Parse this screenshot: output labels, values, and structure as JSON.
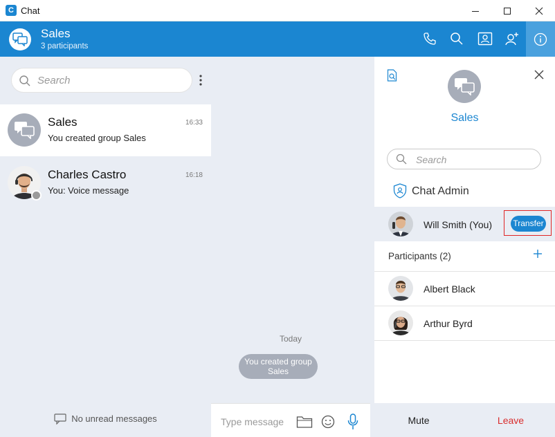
{
  "window": {
    "title": "Chat",
    "logo_letter": "C"
  },
  "header": {
    "title": "Sales",
    "subtitle": "3 participants"
  },
  "conversations": {
    "search_placeholder": "Search",
    "items": [
      {
        "name": "Sales",
        "last_message": "You created group Sales",
        "time": "16:33"
      },
      {
        "name": "Charles Castro",
        "last_message": "You: Voice message",
        "time": "16:18"
      }
    ],
    "no_unread": "No unread messages"
  },
  "chat": {
    "date_label": "Today",
    "system_message": "You created group Sales",
    "composer_placeholder": "Type message"
  },
  "details": {
    "group_name": "Sales",
    "search_placeholder": "Search",
    "admin_header": "Chat Admin",
    "admin": {
      "name": "Will Smith (You)",
      "action": "Transfer"
    },
    "participants_header": "Participants (2)",
    "participants": [
      {
        "name": "Albert Black"
      },
      {
        "name": "Arthur Byrd"
      }
    ],
    "footer": {
      "mute": "Mute",
      "leave": "Leave"
    }
  },
  "colors": {
    "accent": "#1b86d1",
    "panel_bg": "#e9edf4",
    "leave_red": "#d92d2d",
    "highlight_border": "#e02424"
  }
}
